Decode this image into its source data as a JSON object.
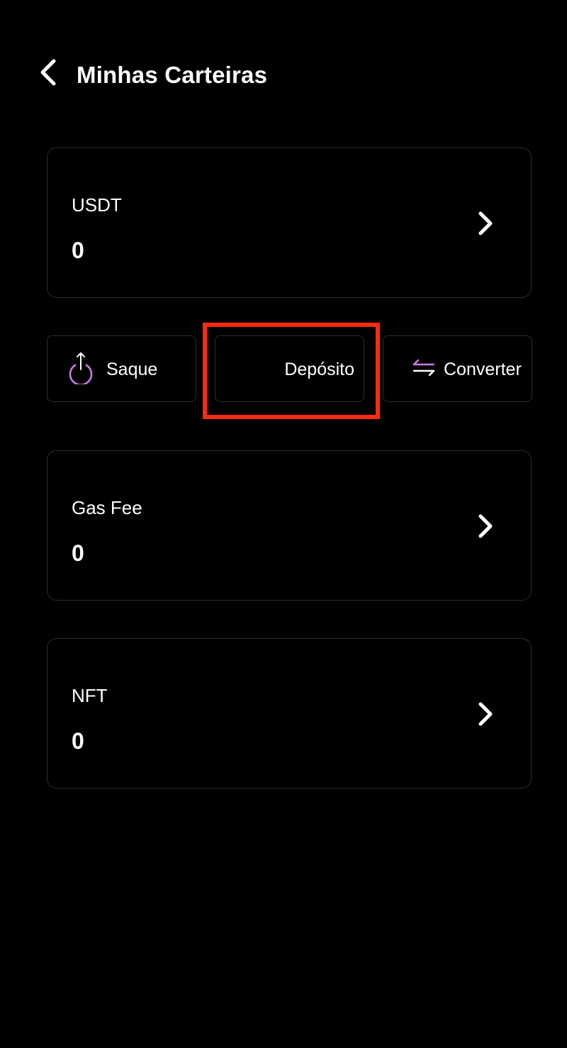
{
  "header": {
    "title": "Minhas Carteiras",
    "back_icon": "chevron-left-icon"
  },
  "wallets": [
    {
      "name": "USDT",
      "balance": "0",
      "icon": "chevron-right-icon"
    },
    {
      "name": "Gas Fee",
      "balance": "0",
      "icon": "chevron-right-icon"
    },
    {
      "name": "NFT",
      "balance": "0",
      "icon": "chevron-right-icon"
    }
  ],
  "actions": {
    "withdraw": {
      "label": "Saque",
      "icon": "upload-icon"
    },
    "deposit": {
      "label": "Depósito"
    },
    "convert": {
      "label": "Converter",
      "icon": "swap-arrows-icon"
    }
  },
  "colors": {
    "background": "#000000",
    "text": "#ffffff",
    "card_border": "#2e2e2e",
    "icon_accent": "#c77be6",
    "highlight": "#ff2a0f"
  }
}
